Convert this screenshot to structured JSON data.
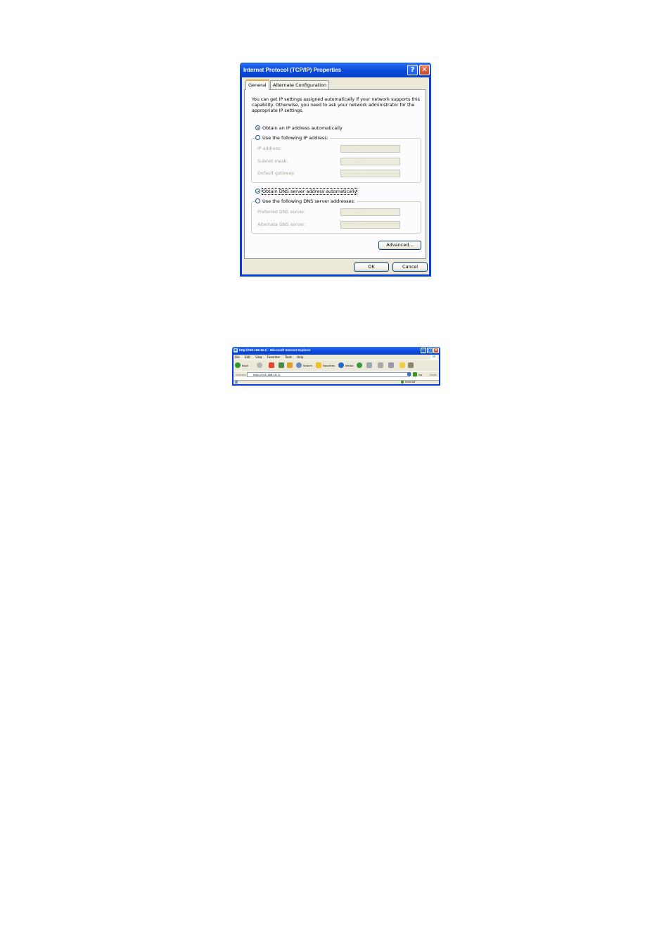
{
  "dialog": {
    "title": "Internet Protocol (TCP/IP) Properties",
    "help_glyph": "?",
    "close_glyph": "✕",
    "tabs": [
      {
        "label": "General"
      },
      {
        "label": "Alternate Configuration"
      }
    ],
    "active_tab": "General",
    "description": "You can get IP settings assigned automatically if your network supports this capability. Otherwise, you need to ask your network administrator for the appropriate IP settings.",
    "ip_mode": {
      "auto_label": "Obtain an IP address automatically",
      "manual_label": "Use the following IP address:",
      "selected": "auto"
    },
    "ip_fields": [
      {
        "label": "IP address:",
        "value": ". . ."
      },
      {
        "label": "Subnet mask:",
        "value": ". . ."
      },
      {
        "label": "Default gateway:",
        "value": ". . ."
      }
    ],
    "dns_mode": {
      "auto_label": "Obtain DNS server address automatically",
      "manual_label": "Use the following DNS server addresses:",
      "selected": "auto"
    },
    "dns_fields": [
      {
        "label": "Preferred DNS server:",
        "value": ". . ."
      },
      {
        "label": "Alternate DNS server:",
        "value": ". . ."
      }
    ],
    "advanced_label": "Advanced...",
    "ok_label": "OK",
    "cancel_label": "Cancel"
  },
  "browser": {
    "title": "http://192.168.16.1/ - Microsoft Internet Explorer",
    "menu": [
      "File",
      "Edit",
      "View",
      "Favorites",
      "Tools",
      "Help"
    ],
    "toolbar": {
      "back_label": "Back",
      "search_label": "Search",
      "favorites_label": "Favorites",
      "media_label": "Media"
    },
    "address_label": "Address",
    "address_value": "http://192.168.16.1/",
    "go_label": "Go",
    "links_label": "Links",
    "status_zone": "Internet",
    "colors": {
      "titlebar": "#0a4ad8",
      "chrome": "#ece9d8"
    }
  }
}
